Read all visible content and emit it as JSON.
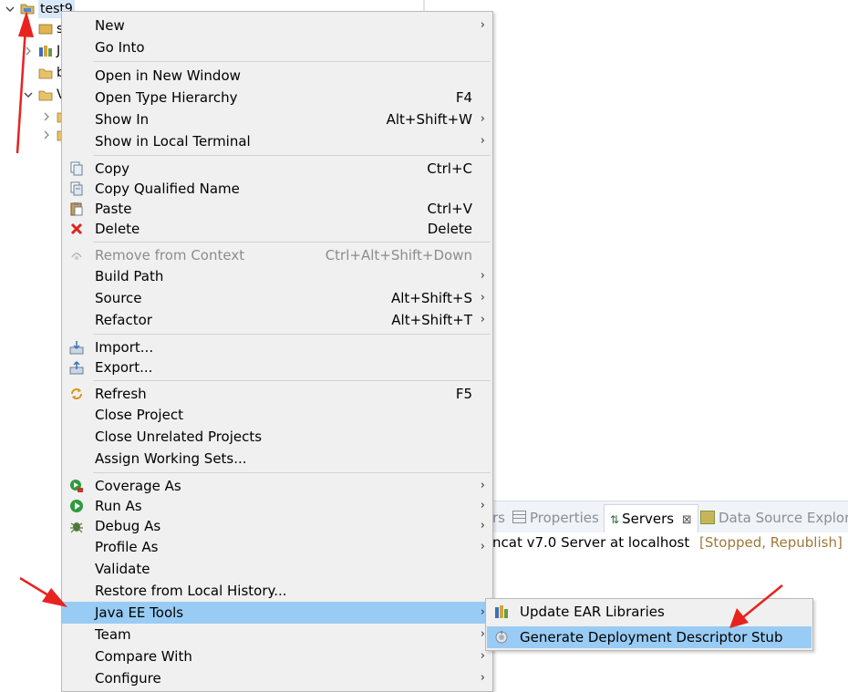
{
  "tree": {
    "project_name": "test9",
    "children": [
      {
        "label": "s"
      },
      {
        "label": "J"
      },
      {
        "label": "b"
      },
      {
        "label": "V"
      }
    ]
  },
  "servers_view": {
    "tabs": [
      {
        "label": "rs"
      },
      {
        "label": "Properties"
      },
      {
        "label": "Servers",
        "close": "⊠"
      },
      {
        "label": "Data Source Explore"
      }
    ],
    "server_name": "ncat v7.0 Server at localhost",
    "server_status": "[Stopped, Republish]"
  },
  "context_menu": {
    "items": [
      {
        "label": "New",
        "shortcut": "",
        "submenu": true
      },
      {
        "label": "Go Into",
        "shortcut": ""
      },
      {
        "label": "Open in New Window",
        "shortcut": ""
      },
      {
        "label": "Open Type Hierarchy",
        "shortcut": "F4"
      },
      {
        "label": "Show In",
        "shortcut": "Alt+Shift+W",
        "submenu": true
      },
      {
        "label": "Show in Local Terminal",
        "shortcut": "",
        "submenu": true
      },
      {
        "label": "Copy",
        "shortcut": "Ctrl+C",
        "icon": "copy-icon"
      },
      {
        "label": "Copy Qualified Name",
        "shortcut": "",
        "icon": "copy-qualified-name-icon"
      },
      {
        "label": "Paste",
        "shortcut": "Ctrl+V",
        "icon": "paste-icon"
      },
      {
        "label": "Delete",
        "shortcut": "Delete",
        "icon": "delete-icon"
      },
      {
        "label": "Remove from Context",
        "shortcut": "Ctrl+Alt+Shift+Down",
        "disabled": true,
        "icon": "remove-context-icon"
      },
      {
        "label": "Build Path",
        "shortcut": "",
        "submenu": true
      },
      {
        "label": "Source",
        "shortcut": "Alt+Shift+S",
        "submenu": true
      },
      {
        "label": "Refactor",
        "shortcut": "Alt+Shift+T",
        "submenu": true
      },
      {
        "label": "Import...",
        "shortcut": "",
        "icon": "import-icon"
      },
      {
        "label": "Export...",
        "shortcut": "",
        "icon": "export-icon"
      },
      {
        "label": "Refresh",
        "shortcut": "F5",
        "icon": "refresh-icon"
      },
      {
        "label": "Close Project",
        "shortcut": ""
      },
      {
        "label": "Close Unrelated Projects",
        "shortcut": ""
      },
      {
        "label": "Assign Working Sets...",
        "shortcut": ""
      },
      {
        "label": "Coverage As",
        "shortcut": "",
        "submenu": true,
        "icon": "coverage-icon"
      },
      {
        "label": "Run As",
        "shortcut": "",
        "submenu": true,
        "icon": "run-icon"
      },
      {
        "label": "Debug As",
        "shortcut": "",
        "submenu": true,
        "icon": "debug-icon"
      },
      {
        "label": "Profile As",
        "shortcut": "",
        "submenu": true
      },
      {
        "label": "Validate",
        "shortcut": ""
      },
      {
        "label": "Restore from Local History...",
        "shortcut": ""
      },
      {
        "label": "Java EE Tools",
        "shortcut": "",
        "submenu": true,
        "highlighted": true
      },
      {
        "label": "Team",
        "shortcut": "",
        "submenu": true
      },
      {
        "label": "Compare With",
        "shortcut": "",
        "submenu": true
      },
      {
        "label": "Configure",
        "shortcut": "",
        "submenu": true
      }
    ]
  },
  "submenu": {
    "items": [
      {
        "label": "Update EAR Libraries",
        "icon": "ear-libraries-icon"
      },
      {
        "label": "Generate Deployment Descriptor Stub",
        "icon": "deployment-descriptor-icon",
        "highlighted": true
      }
    ]
  },
  "icons": {
    "submenu_arrow": "›"
  },
  "colors": {
    "highlight": "#99ccf5",
    "menu_background": "#f0f0f0",
    "annotation_arrow": "#e8231f",
    "status_text": "#a0783a"
  }
}
